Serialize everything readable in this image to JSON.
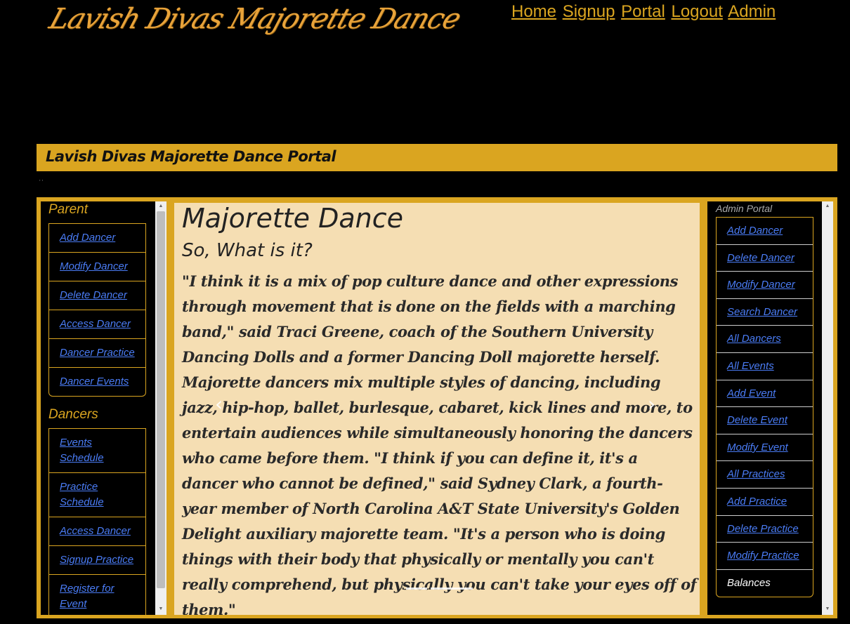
{
  "header": {
    "logo_text": "Lavish Divas Majorette Dance",
    "nav": [
      "Home",
      "Signup",
      "Portal",
      "Logout",
      "Admin"
    ]
  },
  "banner": {
    "title": "Lavish Divas Majorette Dance Portal"
  },
  "tiny_text": "' '",
  "left": {
    "parent_heading": "Parent",
    "parent_items": [
      "Add Dancer",
      "Modify Dancer",
      "Delete Dancer",
      "Access Dancer",
      "Dancer Practice",
      "Dancer Events"
    ],
    "dancers_heading": "Dancers",
    "dancer_items": [
      "Events Schedule",
      "Practice Schedule",
      "Access Dancer",
      "Signup Practice",
      "Register for Event"
    ]
  },
  "content": {
    "title": "Majorette Dance",
    "subtitle": "So, What is it?",
    "quote": "\"I think it is a mix of pop culture dance and other expressions through movement that is done on the fields with a marching band,\" said Traci Greene, coach of the Southern University Dancing Dolls and a former Dancing Doll majorette herself. Majorette dancers mix multiple styles of dancing, including jazz, hip-hop, ballet, burlesque, cabaret, kick lines and more, to entertain audiences while simultaneously honoring the dancers who came before them. \"I think if you can define it, it's a dancer who cannot be defined,\" said Sydney Clark, a fourth-year member of North Carolina A&T State University's Golden Delight auxiliary majorette team. \"It's a person who is doing things with their body that physically or mentally you can't really comprehend, but physically you can't take your eyes off of them.\"",
    "prev": "‹",
    "next": "›"
  },
  "right": {
    "heading": "Admin Portal",
    "items": [
      "Add Dancer",
      "Delete Dancer",
      "Modify Dancer",
      "Search Dancer",
      "All Dancers",
      "All Events",
      "Add Event",
      "Delete Event",
      "Modify Event",
      "All Practices",
      "Add Practice",
      "Delete Practice",
      "Modify Practice"
    ],
    "last_item": "Balances"
  },
  "colors": {
    "accent": "#daa520",
    "link": "#4a7cf5",
    "content_bg": "#f5deb3"
  }
}
